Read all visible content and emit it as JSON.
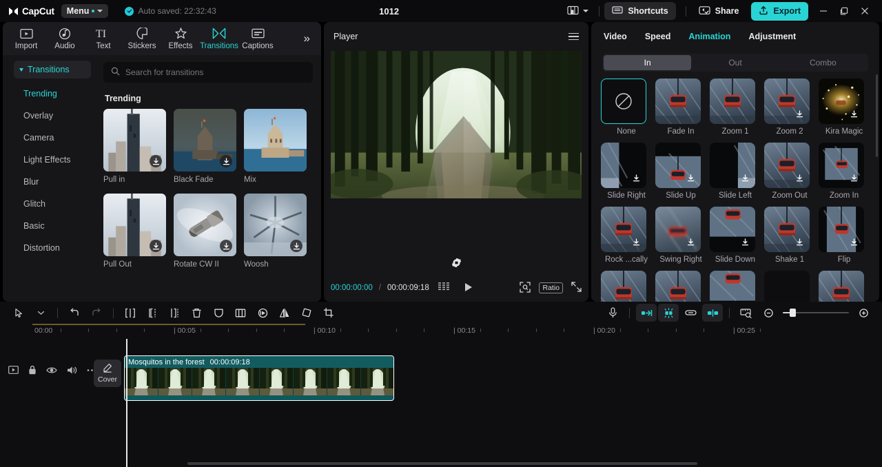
{
  "titlebar": {
    "brand": "CapCut",
    "menu_label": "Menu",
    "autosave_text": "Auto saved: 22:32:43",
    "project_title": "1012",
    "shortcuts_label": "Shortcuts",
    "share_label": "Share",
    "export_label": "Export",
    "layout_icon": "layout-icon",
    "minimize_icon": "minimize-icon",
    "maximize_icon": "maximize-icon",
    "close_icon": "close-icon"
  },
  "left_panel": {
    "tabs": [
      {
        "label": "Import",
        "icon": "import-icon",
        "active": false
      },
      {
        "label": "Audio",
        "icon": "audio-icon",
        "active": false
      },
      {
        "label": "Text",
        "icon": "text-icon",
        "active": false
      },
      {
        "label": "Stickers",
        "icon": "stickers-icon",
        "active": false
      },
      {
        "label": "Effects",
        "icon": "effects-icon",
        "active": false
      },
      {
        "label": "Transitions",
        "icon": "transitions-icon",
        "active": true
      },
      {
        "label": "Captions",
        "icon": "captions-icon",
        "active": false
      }
    ],
    "more_icon": "chevron-double-right-icon",
    "category_header": "Transitions",
    "categories": [
      {
        "label": "Trending",
        "active": true
      },
      {
        "label": "Overlay",
        "active": false
      },
      {
        "label": "Camera",
        "active": false
      },
      {
        "label": "Light Effects",
        "active": false
      },
      {
        "label": "Blur",
        "active": false
      },
      {
        "label": "Glitch",
        "active": false
      },
      {
        "label": "Basic",
        "active": false
      },
      {
        "label": "Distortion",
        "active": false
      }
    ],
    "search_placeholder": "Search for transitions",
    "section_title": "Trending",
    "transitions": [
      {
        "name": "Pull in",
        "download": true,
        "thumb": "city-tower"
      },
      {
        "name": "Black Fade",
        "download": true,
        "thumb": "tower-dark"
      },
      {
        "name": "Mix",
        "download": false,
        "thumb": "tower-bright"
      },
      {
        "name": "Pull Out",
        "download": true,
        "thumb": "city-tower"
      },
      {
        "name": "Rotate CW II",
        "download": true,
        "thumb": "rotate-blur"
      },
      {
        "name": "Woosh",
        "download": true,
        "thumb": "woosh-blur"
      }
    ]
  },
  "player": {
    "title": "Player",
    "menu_icon": "hamburger-icon",
    "current_time": "00:00:00:00",
    "separator": "/",
    "total_time": "00:00:09:18",
    "frames_icon": "frames-icon",
    "play_icon": "play-icon",
    "rotate_icon": "rotate-icon",
    "crop_icon": "crop-preview-icon",
    "ratio_label": "Ratio",
    "fullscreen_icon": "fullscreen-icon"
  },
  "right_panel": {
    "tabs": [
      {
        "label": "Video",
        "active": false
      },
      {
        "label": "Speed",
        "active": false
      },
      {
        "label": "Animation",
        "active": true
      },
      {
        "label": "Adjustment",
        "active": false
      }
    ],
    "segments": [
      {
        "label": "In",
        "active": true
      },
      {
        "label": "Out",
        "active": false
      },
      {
        "label": "Combo",
        "active": false
      }
    ],
    "animations": [
      {
        "name": "None",
        "download": false,
        "selected": true,
        "thumb": "none"
      },
      {
        "name": "Fade In",
        "download": false,
        "selected": false,
        "thumb": "gondola"
      },
      {
        "name": "Zoom 1",
        "download": false,
        "selected": false,
        "thumb": "gondola"
      },
      {
        "name": "Zoom 2",
        "download": true,
        "selected": false,
        "thumb": "gondola"
      },
      {
        "name": "Kira Magic",
        "download": true,
        "selected": false,
        "thumb": "kira"
      },
      {
        "name": "Slide Right",
        "download": true,
        "selected": false,
        "thumb": "slide-right"
      },
      {
        "name": "Slide Up",
        "download": true,
        "selected": false,
        "thumb": "slide-up"
      },
      {
        "name": "Slide Left",
        "download": true,
        "selected": false,
        "thumb": "slide-left"
      },
      {
        "name": "Zoom Out",
        "download": true,
        "selected": false,
        "thumb": "gondola"
      },
      {
        "name": "Zoom In",
        "download": true,
        "selected": false,
        "thumb": "zoom-in"
      },
      {
        "name": "Rock ...cally",
        "download": true,
        "selected": false,
        "thumb": "gondola"
      },
      {
        "name": "Swing Right",
        "download": true,
        "selected": false,
        "thumb": "gondola-blur"
      },
      {
        "name": "Slide Down",
        "download": true,
        "selected": false,
        "thumb": "slide-down"
      },
      {
        "name": "Shake 1",
        "download": true,
        "selected": false,
        "thumb": "gondola"
      },
      {
        "name": "Flip",
        "download": true,
        "selected": false,
        "thumb": "flip"
      }
    ]
  },
  "timeline": {
    "tools_left": [
      {
        "name": "select-tool",
        "icon": "cursor-icon",
        "state": "normal"
      },
      {
        "name": "select-dropdown",
        "icon": "chevron-down-icon",
        "state": "normal"
      },
      {
        "name": "undo",
        "icon": "undo-icon",
        "state": "normal"
      },
      {
        "name": "redo",
        "icon": "redo-icon",
        "state": "disabled"
      },
      {
        "name": "split",
        "icon": "split-icon",
        "state": "normal"
      },
      {
        "name": "trim-left",
        "icon": "trim-left-icon",
        "state": "normal"
      },
      {
        "name": "trim-right",
        "icon": "trim-right-icon",
        "state": "normal"
      },
      {
        "name": "delete",
        "icon": "trash-icon",
        "state": "normal"
      },
      {
        "name": "mask",
        "icon": "mask-icon",
        "state": "normal"
      },
      {
        "name": "freeze",
        "icon": "freeze-icon",
        "state": "normal"
      },
      {
        "name": "reverse",
        "icon": "reverse-icon",
        "state": "normal"
      },
      {
        "name": "mirror",
        "icon": "mirror-icon",
        "state": "normal"
      },
      {
        "name": "rotate",
        "icon": "rotate-square-icon",
        "state": "normal"
      },
      {
        "name": "crop",
        "icon": "crop-icon",
        "state": "normal"
      }
    ],
    "tools_right": [
      {
        "name": "record-voiceover",
        "icon": "microphone-icon",
        "state": "normal"
      },
      {
        "name": "auto-fit",
        "icon": "fit-icon",
        "state": "on"
      },
      {
        "name": "magnetic-snap",
        "icon": "magnet-snap-icon",
        "state": "on"
      },
      {
        "name": "link-toggle",
        "icon": "link-icon",
        "state": "normal"
      },
      {
        "name": "adsorption",
        "icon": "adsorption-icon",
        "state": "on"
      },
      {
        "name": "preview-scale",
        "icon": "preview-scale-icon",
        "state": "normal"
      },
      {
        "name": "zoom-out",
        "icon": "zoom-out-icon",
        "state": "normal"
      },
      {
        "name": "zoom-slider",
        "icon": "slider-icon",
        "state": "normal"
      },
      {
        "name": "zoom-in",
        "icon": "zoom-in-icon",
        "state": "normal"
      }
    ],
    "ruler_labels": [
      "00:00",
      "00:05",
      "00:10",
      "00:15",
      "00:20",
      "00:25"
    ],
    "track_head_icons": [
      "track-video-icon",
      "lock-icon",
      "eye-icon",
      "volume-icon",
      "more-icon"
    ],
    "cover_label": "Cover",
    "cover_icon": "pencil-icon",
    "clip": {
      "title": "Mosquitos in the forest",
      "duration": "00:00:09:18"
    },
    "playhead_time": "00:00"
  },
  "colors": {
    "accent": "#2ad4d4",
    "clip": "#0d5a5e",
    "panel_bg": "#161619",
    "app_bg": "#000000"
  }
}
